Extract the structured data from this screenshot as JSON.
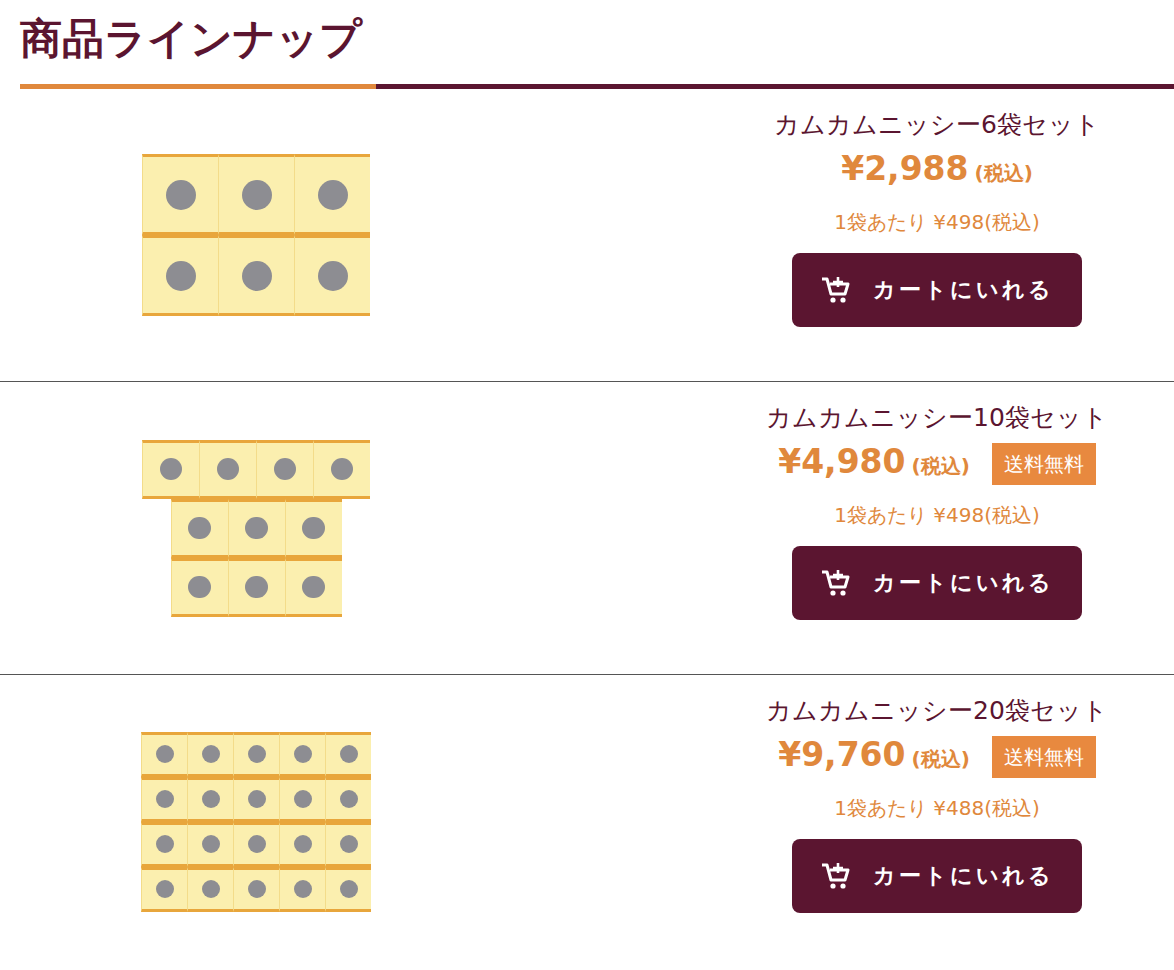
{
  "heading": "商品ラインナップ",
  "button_label": "カートにいれる",
  "shipping_badge": "送料無料",
  "products": [
    {
      "name": "カムカムニッシー6袋セット",
      "price": "¥2,988",
      "tax": "(税込)",
      "free_shipping": false,
      "per_bag": "1袋あたり ¥498(税込)",
      "image_rows": [
        3,
        3
      ]
    },
    {
      "name": "カムカムニッシー10袋セット",
      "price": "¥4,980",
      "tax": "(税込)",
      "free_shipping": true,
      "per_bag": "1袋あたり ¥498(税込)",
      "image_rows": [
        4,
        3,
        3
      ]
    },
    {
      "name": "カムカムニッシー20袋セット",
      "price": "¥9,760",
      "tax": "(税込)",
      "free_shipping": true,
      "per_bag": "1袋あたり ¥488(税込)",
      "image_rows": [
        5,
        5,
        5,
        5
      ]
    }
  ]
}
